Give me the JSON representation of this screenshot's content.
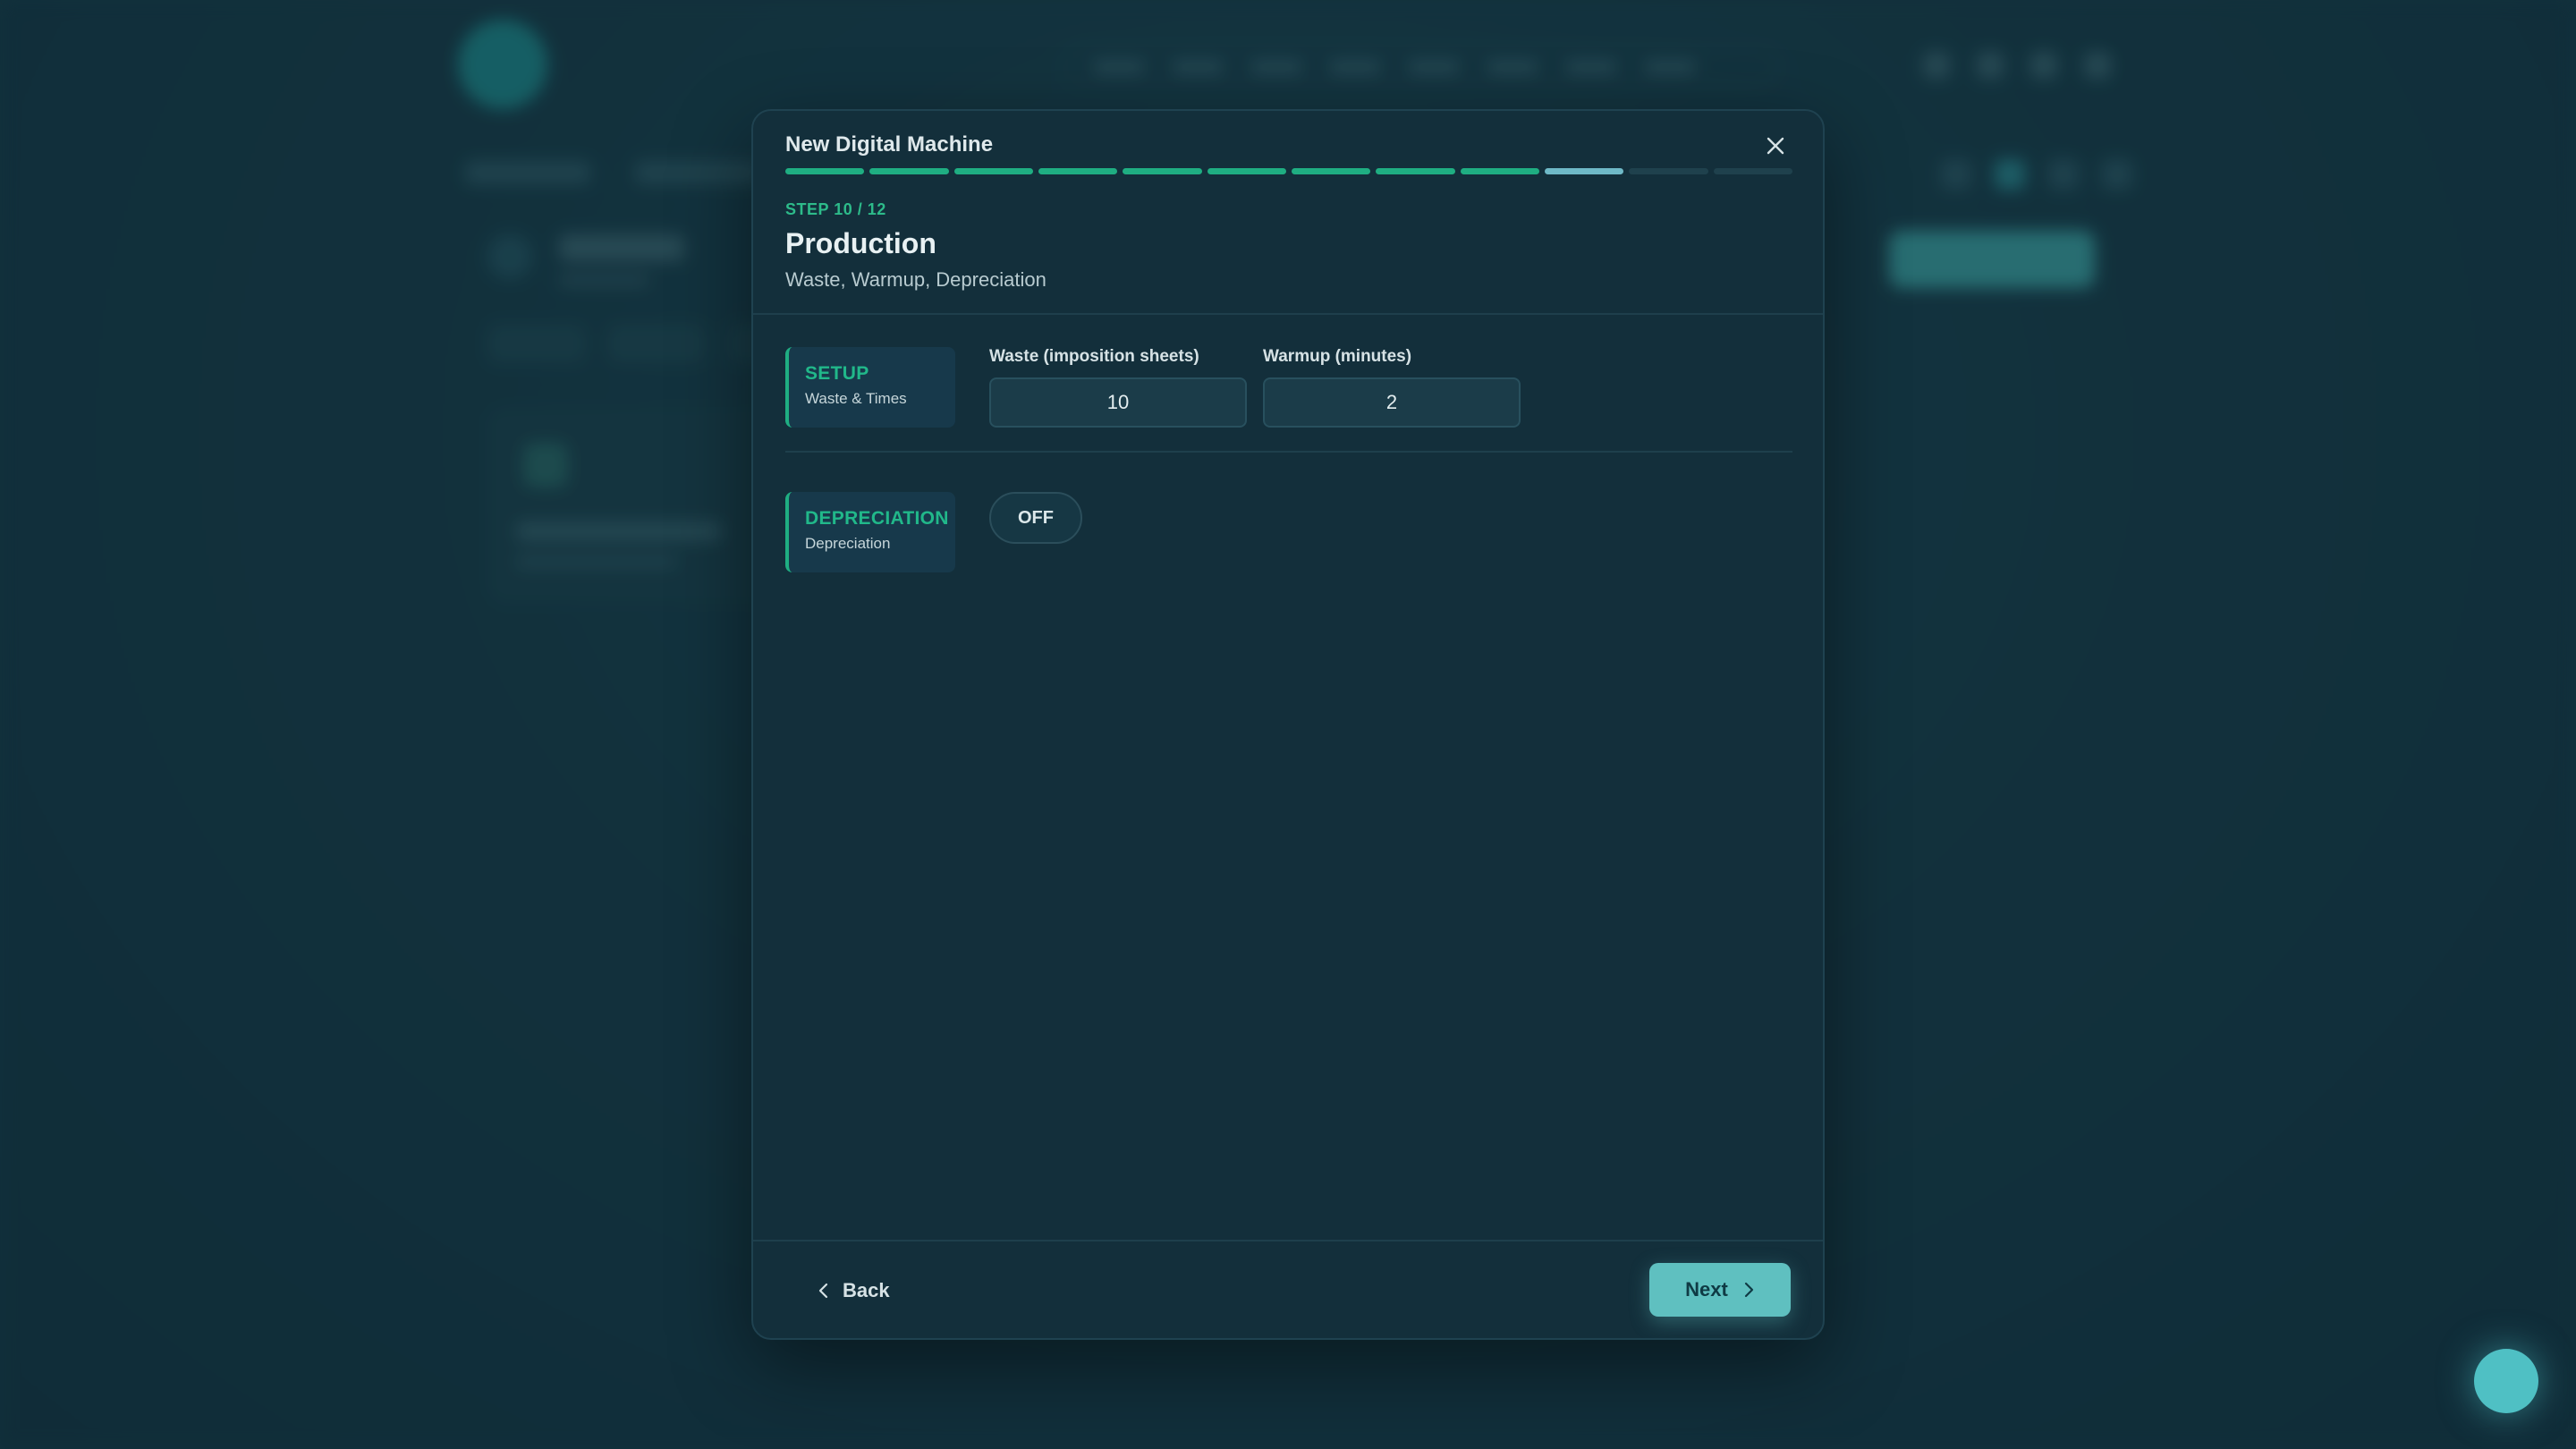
{
  "modal": {
    "title": "New Digital Machine",
    "close_icon": "close-icon",
    "progress": {
      "total_steps": 12,
      "completed_steps": 9,
      "current_step": 10
    },
    "step_label": "STEP 10 / 12",
    "section_title": "Production",
    "section_subtitle": "Waste, Warmup, Depreciation"
  },
  "setup": {
    "tag_title": "SETUP",
    "tag_subtitle": "Waste & Times",
    "waste_label": "Waste (imposition sheets)",
    "waste_value": "10",
    "warmup_label": "Warmup (minutes)",
    "warmup_value": "2"
  },
  "depreciation": {
    "tag_title": "DEPRECIATION",
    "tag_subtitle": "Depreciation",
    "toggle_label": "OFF"
  },
  "footer": {
    "back_label": "Back",
    "back_icon": "chevron-left-icon",
    "next_label": "Next",
    "next_icon": "chevron-right-icon"
  },
  "colors": {
    "accent_green": "#1fae82",
    "current_step": "#6fb9c7",
    "primary_button": "#5fc0c0",
    "modal_bg": "#132f3b"
  }
}
